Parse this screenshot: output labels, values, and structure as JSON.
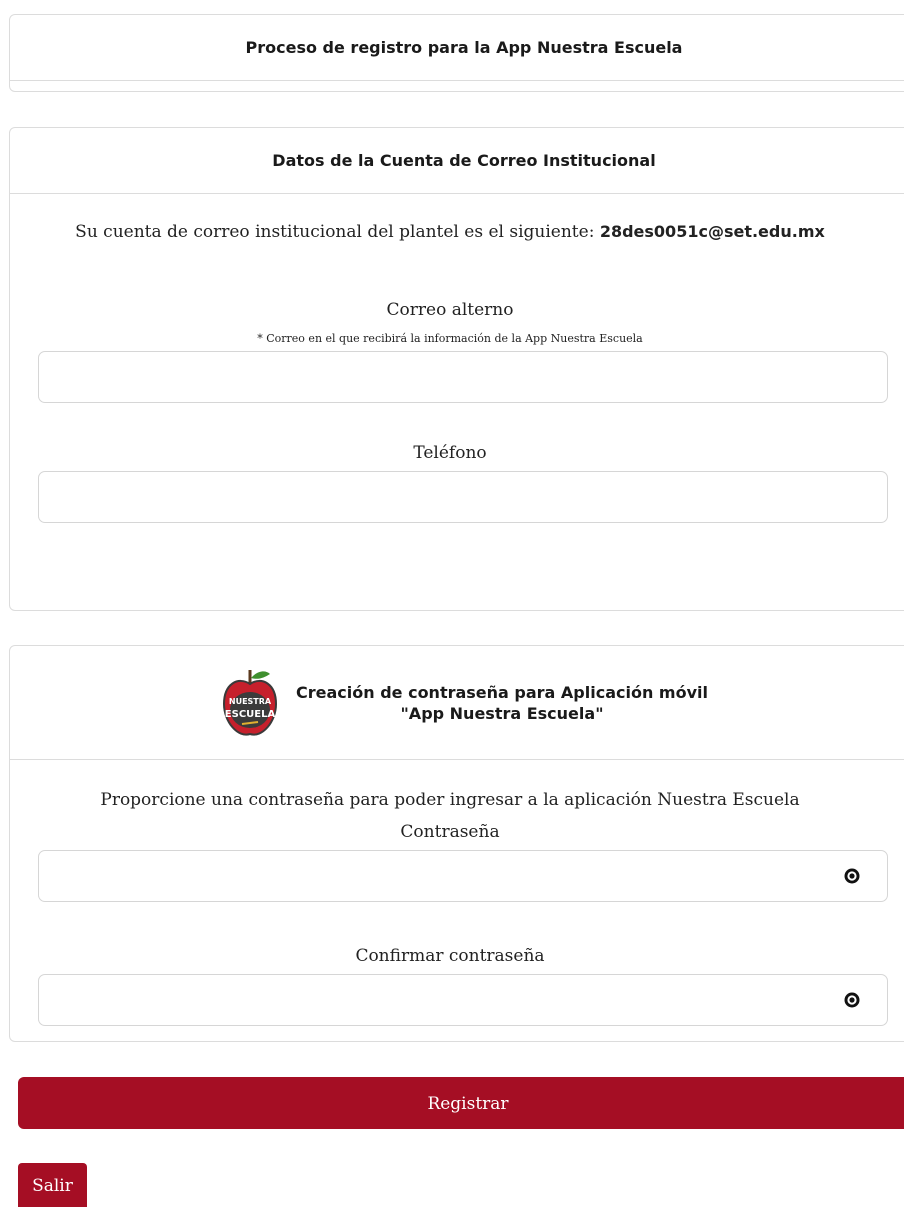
{
  "page": {
    "title": "Proceso de registro para la App Nuestra Escuela"
  },
  "email_section": {
    "header": "Datos de la Cuenta de Correo Institucional",
    "info_prefix": "Su cuenta de correo institucional del plantel es el siguiente:",
    "institutional_email": "28des0051c@set.edu.mx",
    "alt_email_label": "Correo alterno",
    "alt_email_note": "* Correo en el que recibirá la información de la App Nuestra Escuela",
    "alt_email_value": "",
    "phone_label": "Teléfono",
    "phone_value": ""
  },
  "password_section": {
    "header_line1": "Creación de contraseña para Aplicación móvil",
    "header_line2": "\"App Nuestra Escuela\"",
    "logo_text_top": "NUESTRA",
    "logo_text_bottom": "ESCUELA",
    "instructions": "Proporcione una contraseña para poder ingresar a la aplicación Nuestra Escuela",
    "password_label": "Contraseña",
    "password_value": "",
    "confirm_label": "Confirmar contraseña",
    "confirm_value": ""
  },
  "actions": {
    "register_label": "Registrar",
    "exit_label": "Salir"
  },
  "colors": {
    "primary": "#a50e24",
    "border": "#dcdcdc"
  },
  "icons": {
    "toggle_password": "eye-icon",
    "logo": "apple-logo-icon"
  }
}
